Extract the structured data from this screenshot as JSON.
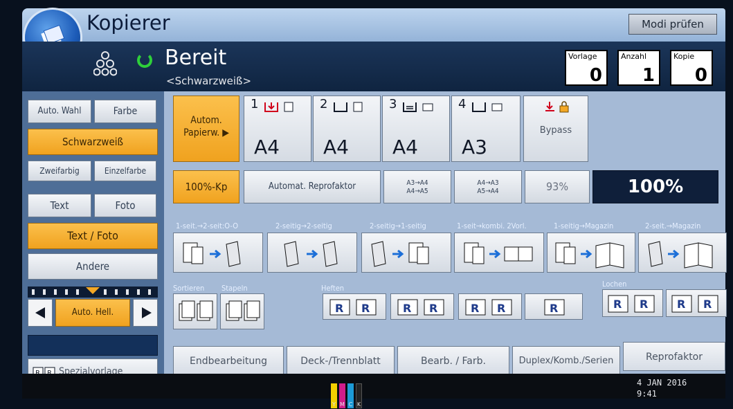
{
  "header": {
    "title": "Kopierer",
    "mode_check_label": "Modi prüfen"
  },
  "status": {
    "state": "Bereit",
    "mode": "<Schwarzweiß>",
    "counters": [
      {
        "label": "Vorlage",
        "value": "0"
      },
      {
        "label": "Anzahl",
        "value": "1"
      },
      {
        "label": "Kopie",
        "value": "0"
      }
    ]
  },
  "color_mode": {
    "auto": "Auto. Wahl",
    "color": "Farbe",
    "bw": "Schwarzweiß",
    "two_color": "Zweifarbig",
    "single_color": "Einzelfarbe"
  },
  "original_type": {
    "text": "Text",
    "photo": "Foto",
    "text_photo": "Text / Foto",
    "other": "Andere"
  },
  "density": {
    "auto": "Auto. Hell."
  },
  "special_original": "Spezialvorlage",
  "paper": {
    "auto": "Autom. Papierw.",
    "trays": [
      {
        "num": "1",
        "size": "A4"
      },
      {
        "num": "2",
        "size": "A4"
      },
      {
        "num": "3",
        "size": "A4"
      },
      {
        "num": "4",
        "size": "A3"
      }
    ],
    "bypass": "Bypass"
  },
  "reduce_enlarge": {
    "full_size": "100%-Kp",
    "auto": "Automat. Reprofaktor",
    "preset1_line1": "A3→A4",
    "preset1_line2": "A4→A5",
    "preset2_line1": "A4→A3",
    "preset2_line2": "A5→A4",
    "preset3": "93%",
    "current": "100%"
  },
  "duplex": {
    "labels": [
      "1-seit.→2-seit:O-O",
      "2-seitig→2-seitig",
      "2-seitig→1-seitig",
      "1-seit→kombi. 2Vorl.",
      "1-seitig→Magazin",
      "2-seit.→Magazin"
    ]
  },
  "finishing": {
    "sort": "Sortieren",
    "stack": "Stapeln",
    "staple": "Heften",
    "punch": "Lochen"
  },
  "tabs": [
    "Endbearbeitung",
    "Deck-/Trennblatt",
    "Bearb. / Farb.",
    "Duplex/Komb./Serien",
    "Reprofaktor"
  ],
  "footer": {
    "date": "4 JAN  2016",
    "time": "9:41",
    "ymck": [
      "Y",
      "M",
      "C",
      "K"
    ]
  },
  "colors": {
    "selected": "#f3a825",
    "panel": "#a5bad6",
    "ymck": [
      "#f4d000",
      "#d01c8b",
      "#1c9ad6",
      "#222222"
    ]
  }
}
